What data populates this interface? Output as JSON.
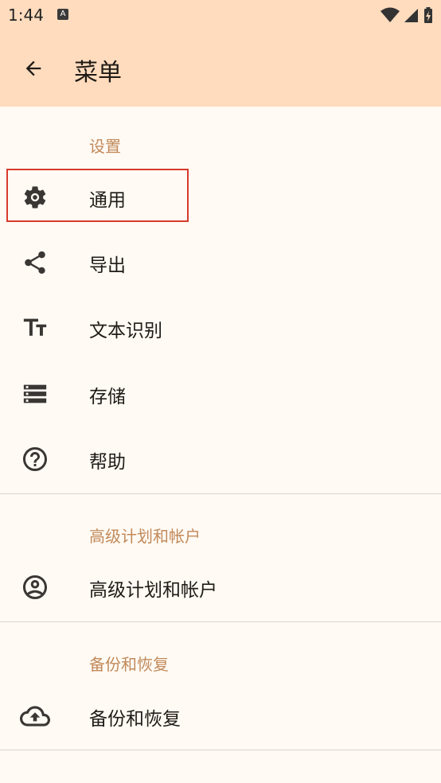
{
  "status_bar": {
    "time": "1:44",
    "app_icon_letter": "A"
  },
  "app_bar": {
    "title": "菜单"
  },
  "sections": {
    "settings": {
      "header": "设置",
      "items": [
        {
          "label": "通用",
          "icon": "gear-icon"
        },
        {
          "label": "导出",
          "icon": "share-icon"
        },
        {
          "label": "文本识别",
          "icon": "text-size-icon"
        },
        {
          "label": "存储",
          "icon": "storage-icon"
        },
        {
          "label": "帮助",
          "icon": "help-icon"
        }
      ]
    },
    "premium": {
      "header": "高级计划和帐户",
      "items": [
        {
          "label": "高级计划和帐户",
          "icon": "account-icon"
        }
      ]
    },
    "backup": {
      "header": "备份和恢复",
      "items": [
        {
          "label": "备份和恢复",
          "icon": "cloud-upload-icon"
        }
      ]
    }
  },
  "colors": {
    "app_bar": "#ffdcbe",
    "background": "#fffaf4",
    "section_header": "#c28a5a",
    "highlight": "#d83a2b"
  }
}
